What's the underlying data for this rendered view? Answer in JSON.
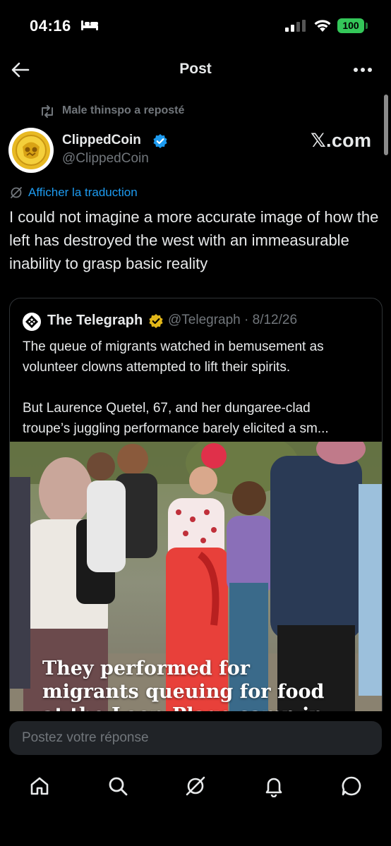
{
  "status": {
    "time": "04:16",
    "battery": "100"
  },
  "nav": {
    "title": "Post"
  },
  "repost": {
    "text": "Male thinspo a reposté"
  },
  "author": {
    "name": "ClippedCoin",
    "handle": "@ClippedCoin"
  },
  "watermark": "𝕏.com",
  "translate_link": "Afficher la traduction",
  "post_text": "I could not imagine a more accurate image of how the left has destroyed the west with an immeasurable inability to grasp basic reality",
  "quote": {
    "name": "The Telegraph",
    "handle_date": "@Telegraph · 8/12/26",
    "line1": "The queue of migrants watched in bemusement as",
    "line2": "volunteer clowns attempted to lift their spirits.",
    "line3": "But Laurence Quetel, 67, and her dungaree-clad",
    "line4": "troupe’s juggling performance barely elicited a sm...",
    "image_caption_line1": "They performed for",
    "image_caption_line2": "migrants queuing for food",
    "image_caption_line3": "at the Loon-Plage camp in"
  },
  "reply": {
    "placeholder": "Postez votre réponse"
  },
  "tabs": [
    {
      "icon": "home-icon"
    },
    {
      "icon": "search-icon"
    },
    {
      "icon": "grok-icon"
    },
    {
      "icon": "notifications-icon"
    },
    {
      "icon": "messages-icon"
    }
  ],
  "colors": {
    "background": "#000000",
    "text": "#e7e9ea",
    "muted": "#71767b",
    "link": "#1d9bf0",
    "verified": "#1d9bf0",
    "gold_verified": "#e2b719",
    "battery": "#34c759"
  }
}
